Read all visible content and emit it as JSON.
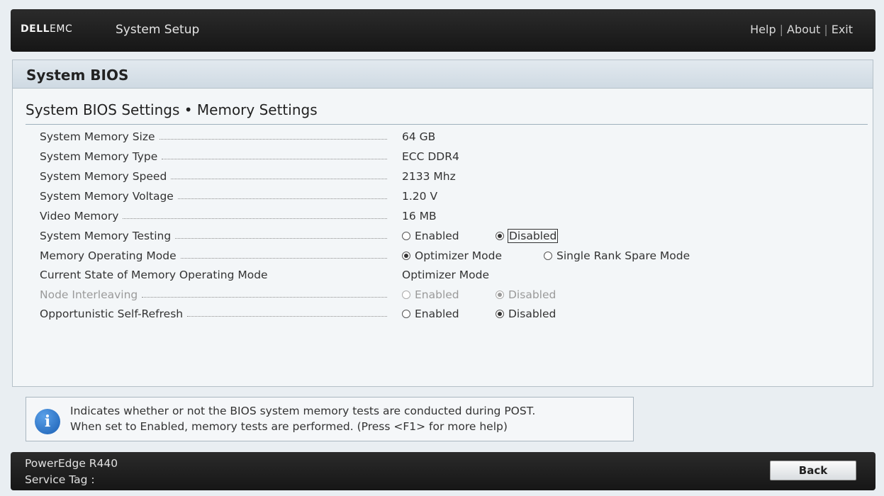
{
  "header": {
    "logo_dell": "DELL",
    "logo_emc": "EMC",
    "title": "System Setup",
    "links": [
      "Help",
      "About",
      "Exit"
    ]
  },
  "panel": {
    "title": "System BIOS",
    "section_title": "System BIOS Settings • Memory Settings"
  },
  "settings": {
    "memory_size": {
      "label": "System Memory Size",
      "value": "64 GB"
    },
    "memory_type": {
      "label": "System Memory Type",
      "value": "ECC DDR4"
    },
    "memory_speed": {
      "label": "System Memory Speed",
      "value": "2133 Mhz"
    },
    "memory_voltage": {
      "label": "System Memory Voltage",
      "value": "1.20 V"
    },
    "video_memory": {
      "label": "Video Memory",
      "value": "16 MB"
    },
    "memory_testing": {
      "label": "System Memory Testing",
      "options": [
        "Enabled",
        "Disabled"
      ],
      "selected": "Disabled"
    },
    "operating_mode": {
      "label": "Memory Operating Mode",
      "options": [
        "Optimizer Mode",
        "Single Rank Spare Mode"
      ],
      "selected": "Optimizer Mode"
    },
    "current_mode": {
      "label": "Current State of Memory Operating Mode",
      "value": "Optimizer Mode"
    },
    "node_interleaving": {
      "label": "Node Interleaving",
      "options": [
        "Enabled",
        "Disabled"
      ],
      "selected": "Disabled",
      "disabled": true
    },
    "self_refresh": {
      "label": "Opportunistic Self-Refresh",
      "options": [
        "Enabled",
        "Disabled"
      ],
      "selected": "Disabled"
    }
  },
  "help": {
    "line1": "Indicates whether or not the BIOS system memory tests are conducted during POST.",
    "line2": "When set to Enabled, memory tests are performed. (Press <F1> for more help)"
  },
  "footer": {
    "model": "PowerEdge R440",
    "service_tag": "Service Tag :",
    "back_label": "Back"
  }
}
